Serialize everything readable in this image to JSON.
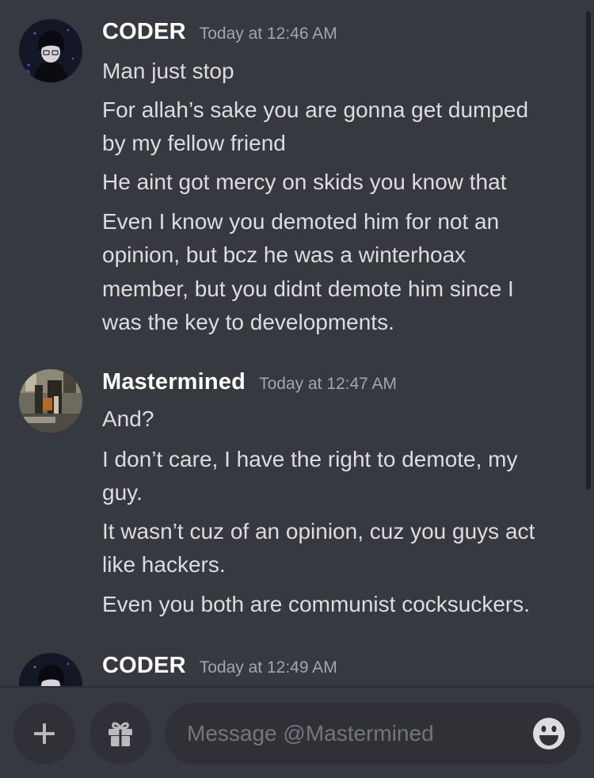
{
  "messages": [
    {
      "author": "CODER",
      "timestamp": "Today at 12:46 AM",
      "avatar_icon": "anime-character-avatar",
      "lines": [
        "Man just stop",
        "For allah’s sake you are gonna get dumped",
        "by my fellow friend",
        "He aint got mercy on skids you know that",
        "Even I know you demoted him for not an",
        "opinion, but bcz he was a winterhoax",
        "member, but you didnt demote him since I",
        "was the key to developments."
      ]
    },
    {
      "author": "Mastermined",
      "timestamp": "Today at 12:47 AM",
      "avatar_icon": "room-photo-avatar",
      "lines": [
        "And?",
        "I don’t care, I have the right to demote, my",
        "guy.",
        "It wasn’t cuz of an opinion, cuz you guys act",
        "like hackers.",
        "Even you both are communist cocksuckers."
      ]
    },
    {
      "author": "CODER",
      "timestamp": "Today at 12:49 AM",
      "avatar_icon": "anime-character-avatar",
      "lines": []
    }
  ],
  "composer": {
    "placeholder": "Message @Mastermined",
    "add_icon": "plus-icon",
    "gift_icon": "gift-icon",
    "emoji_icon": "emoji-icon"
  },
  "colors": {
    "background": "#36393f",
    "input_background": "#2f3136",
    "author": "#ffffff",
    "text": "#dcddde",
    "timestamp": "#a3a6aa",
    "placeholder": "#72767d"
  }
}
